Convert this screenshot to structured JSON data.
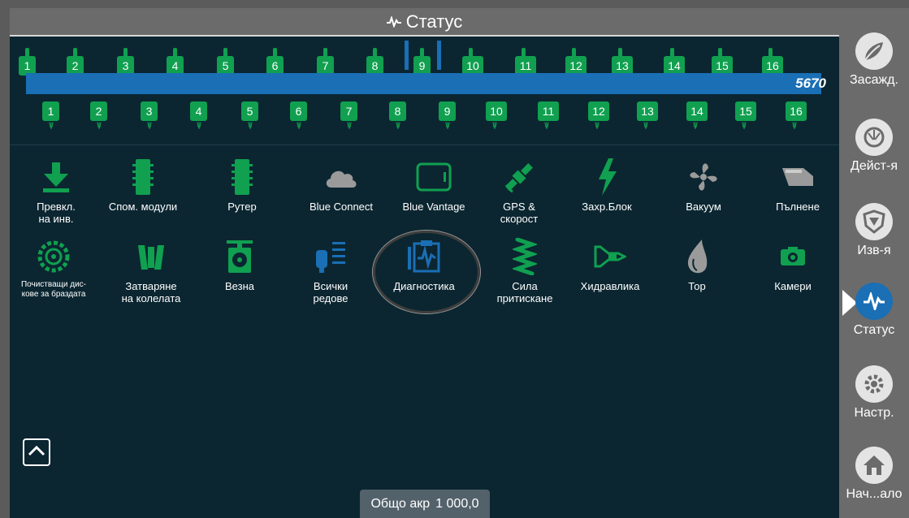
{
  "header": {
    "title": "Статус"
  },
  "rows": {
    "top_labels": [
      "1",
      "2",
      "3",
      "4",
      "5",
      "6",
      "7",
      "8",
      "9",
      "10",
      "11",
      "12",
      "13",
      "14",
      "15",
      "16"
    ],
    "bottom_labels": [
      "1",
      "2",
      "3",
      "4",
      "5",
      "6",
      "7",
      "8",
      "9",
      "10",
      "11",
      "12",
      "13",
      "14",
      "15",
      "16"
    ],
    "total": "5670"
  },
  "tiles_row1": [
    {
      "label": "Превкл.\nна инв.",
      "icon": "download-icon"
    },
    {
      "label": "Спом. модули",
      "icon": "module-icon"
    },
    {
      "label": "Рутер",
      "icon": "router-icon"
    },
    {
      "label": "Blue Connect",
      "icon": "cloud-icon"
    },
    {
      "label": "Blue Vantage",
      "icon": "display-icon"
    },
    {
      "label": "GPS &\nскорост",
      "icon": "satellite-icon"
    },
    {
      "label": "Захр.Блок",
      "icon": "lightning-icon"
    },
    {
      "label": "Вакуум",
      "icon": "fan-icon"
    },
    {
      "label": "Пълнене",
      "icon": "fill-icon"
    }
  ],
  "tiles_row2": [
    {
      "label": "Почистващи дис-\nкове за браздата",
      "icon": "disc-icon"
    },
    {
      "label": "Затваряне\nна колелата",
      "icon": "closing-wheels-icon"
    },
    {
      "label": "Везна",
      "icon": "scale-icon"
    },
    {
      "label": "Всички\nредове",
      "icon": "all-rows-icon"
    },
    {
      "label": "Диагностика",
      "icon": "diagnostics-icon"
    },
    {
      "label": "Сила\nпритискане",
      "icon": "spring-icon"
    },
    {
      "label": "Хидравлика",
      "icon": "hydraulics-icon"
    },
    {
      "label": "Тор",
      "icon": "fertilizer-drop-icon"
    },
    {
      "label": "Камери",
      "icon": "camera-icon"
    }
  ],
  "footer": {
    "area_label": "Общо акр",
    "area_value": "1 000,0"
  },
  "sidebar": [
    {
      "label": "Засажд.",
      "icon": "planting-icon"
    },
    {
      "label": "Дейст-я",
      "icon": "actions-icon"
    },
    {
      "label": "Изв-я",
      "icon": "alerts-shield-icon"
    },
    {
      "label": "Статус",
      "icon": "status-icon"
    },
    {
      "label": "Настр.",
      "icon": "settings-icon"
    },
    {
      "label": "Нач...ало",
      "icon": "home-icon"
    }
  ],
  "colors": {
    "green": "#10a050",
    "blue": "#1a6fb5",
    "panel": "#0b2631",
    "gray": "#6b6b6b"
  }
}
